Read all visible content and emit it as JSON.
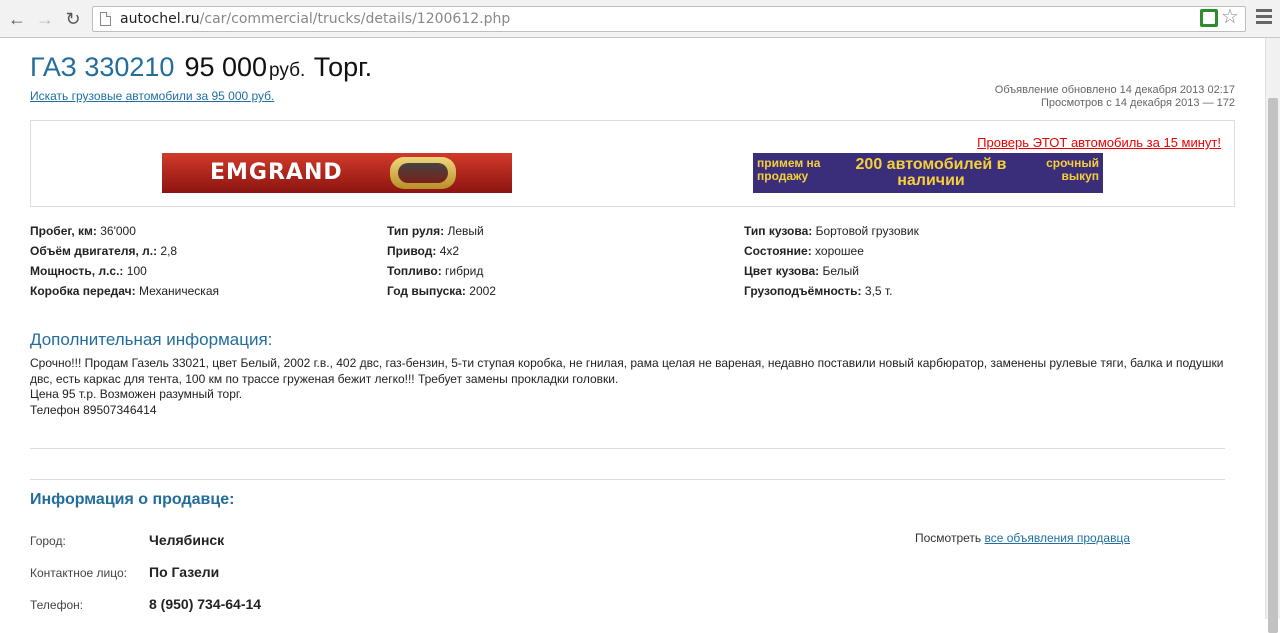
{
  "browser": {
    "url_host": "autochel.ru",
    "url_path": "/car/commercial/trucks/details/1200612.php"
  },
  "listing": {
    "model": "ГАЗ 330210",
    "price": "95 000",
    "currency": "руб.",
    "negotiable": "Торг.",
    "search_link": "Искать грузовые автомобили за 95 000 руб.",
    "updated": "Объявление обновлено 14 декабря 2013 02:17",
    "views": "Просмотров с 14 декабря 2013 — 172"
  },
  "ads": {
    "check_link": "Проверь ЭТОТ автомобиль за 15 минут!",
    "banner_left": "EMGRAND",
    "banner_right_left": "примем на продажу",
    "banner_right_center": "200 автомобилей в наличии",
    "banner_right_right": "срочный выкуп"
  },
  "specs": {
    "col1": [
      {
        "label": "Пробег, км:",
        "value": "36'000"
      },
      {
        "label": "Объём двигателя, л.:",
        "value": "2,8"
      },
      {
        "label": "Мощность, л.с.:",
        "value": "100"
      },
      {
        "label": "Коробка передач:",
        "value": "Механическая"
      }
    ],
    "col2": [
      {
        "label": "Тип руля:",
        "value": "Левый"
      },
      {
        "label": "Привод:",
        "value": "4x2"
      },
      {
        "label": "Топливо:",
        "value": " гибрид"
      },
      {
        "label": "Год выпуска:",
        "value": "2002"
      }
    ],
    "col3": [
      {
        "label": "Тип кузова:",
        "value": "Бортовой грузовик"
      },
      {
        "label": "Состояние:",
        "value": "хорошее"
      },
      {
        "label": "Цвет кузова:",
        "value": "Белый"
      },
      {
        "label": "Грузоподъёмность:",
        "value": " 3,5 т."
      }
    ]
  },
  "additional": {
    "title": "Дополнительная информация:",
    "line1": "Срочно!!! Продам Газель 33021, цвет Белый, 2002 г.в., 402 двс, газ-бензин, 5-ти ступая коробка, не гнилая, рама целая не вареная, недавно поставили новый карбюратор, заменены рулевые тяги, балка и подушки двс, есть каркас для тента, 100 км по трассе груженая бежит легко!!! Требует замены прокладки головки.",
    "line2": "Цена 95 т.р. Возможен разумный торг.",
    "line3": "Телефон 89507346414"
  },
  "seller": {
    "title": "Информация о продавце:",
    "city_label": "Город:",
    "city": "Челябинск",
    "contact_label": "Контактное лицо:",
    "contact": "По Газели",
    "phone_label": "Телефон:",
    "phone": "8 (950) 734-64-14",
    "all_prefix": "Посмотреть",
    "all_link": "все объявления продавца"
  }
}
